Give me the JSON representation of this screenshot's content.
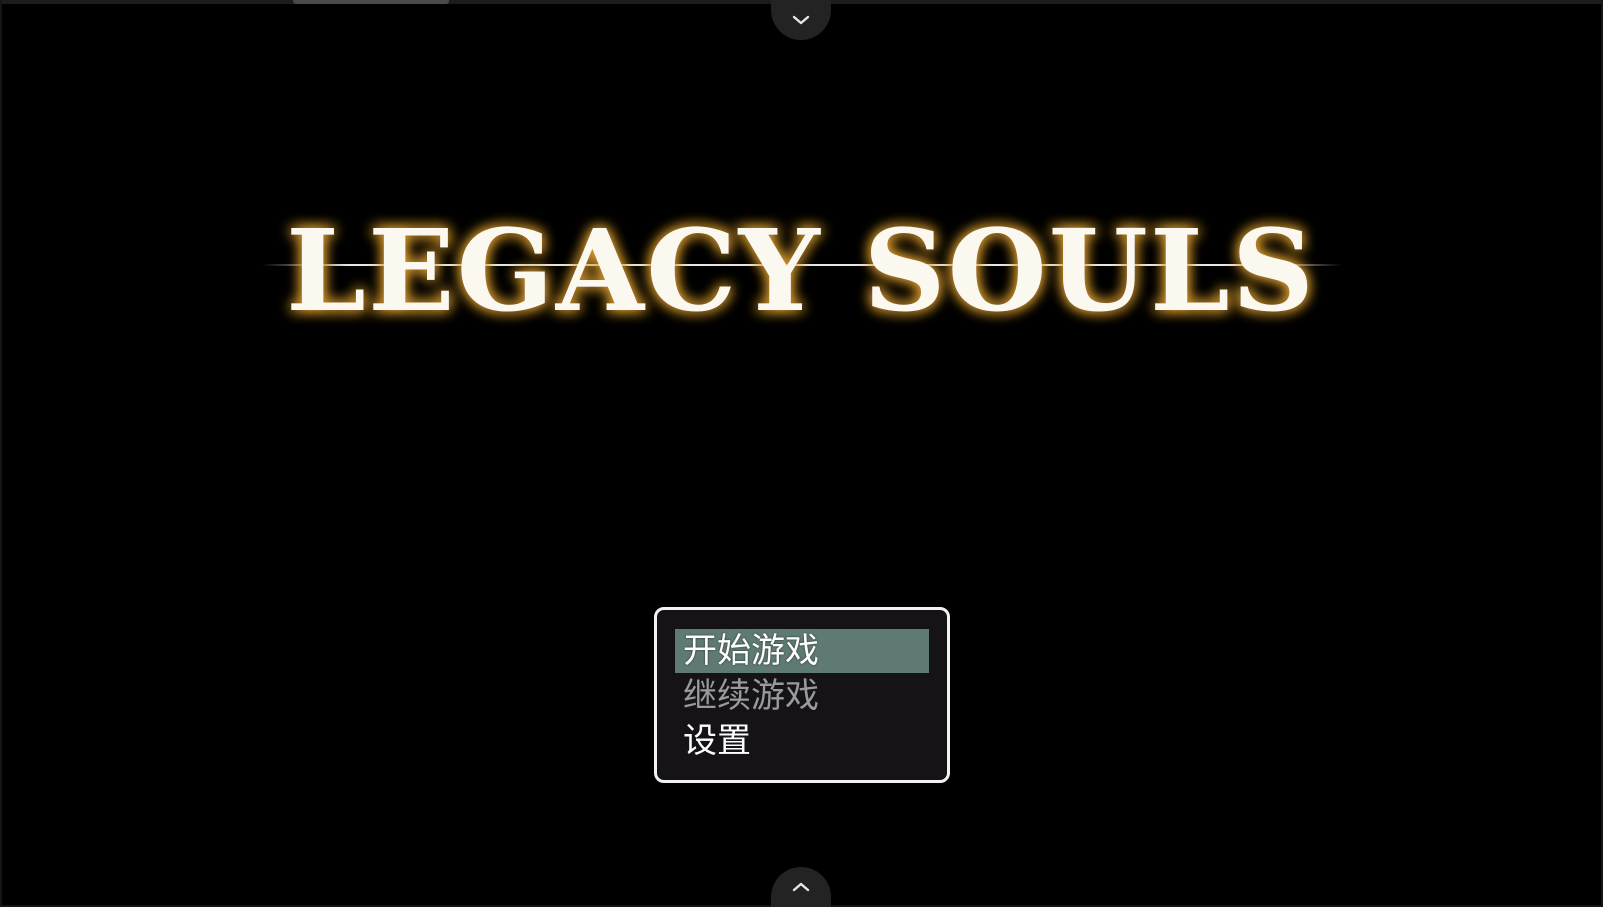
{
  "game": {
    "title": "LEGACY SOULS",
    "title_glow_color": "#e0a030"
  },
  "title_menu": {
    "items": [
      {
        "label": "开始游戏",
        "state": "selected"
      },
      {
        "label": "继续游戏",
        "state": "disabled"
      },
      {
        "label": "设置",
        "state": "normal"
      }
    ],
    "selection_color": "#5f7a73",
    "border_color": "#f2f2f2"
  },
  "window_controls": {
    "top_tab_icon": "chevron-down-icon",
    "bottom_tab_icon": "chevron-up-icon"
  }
}
